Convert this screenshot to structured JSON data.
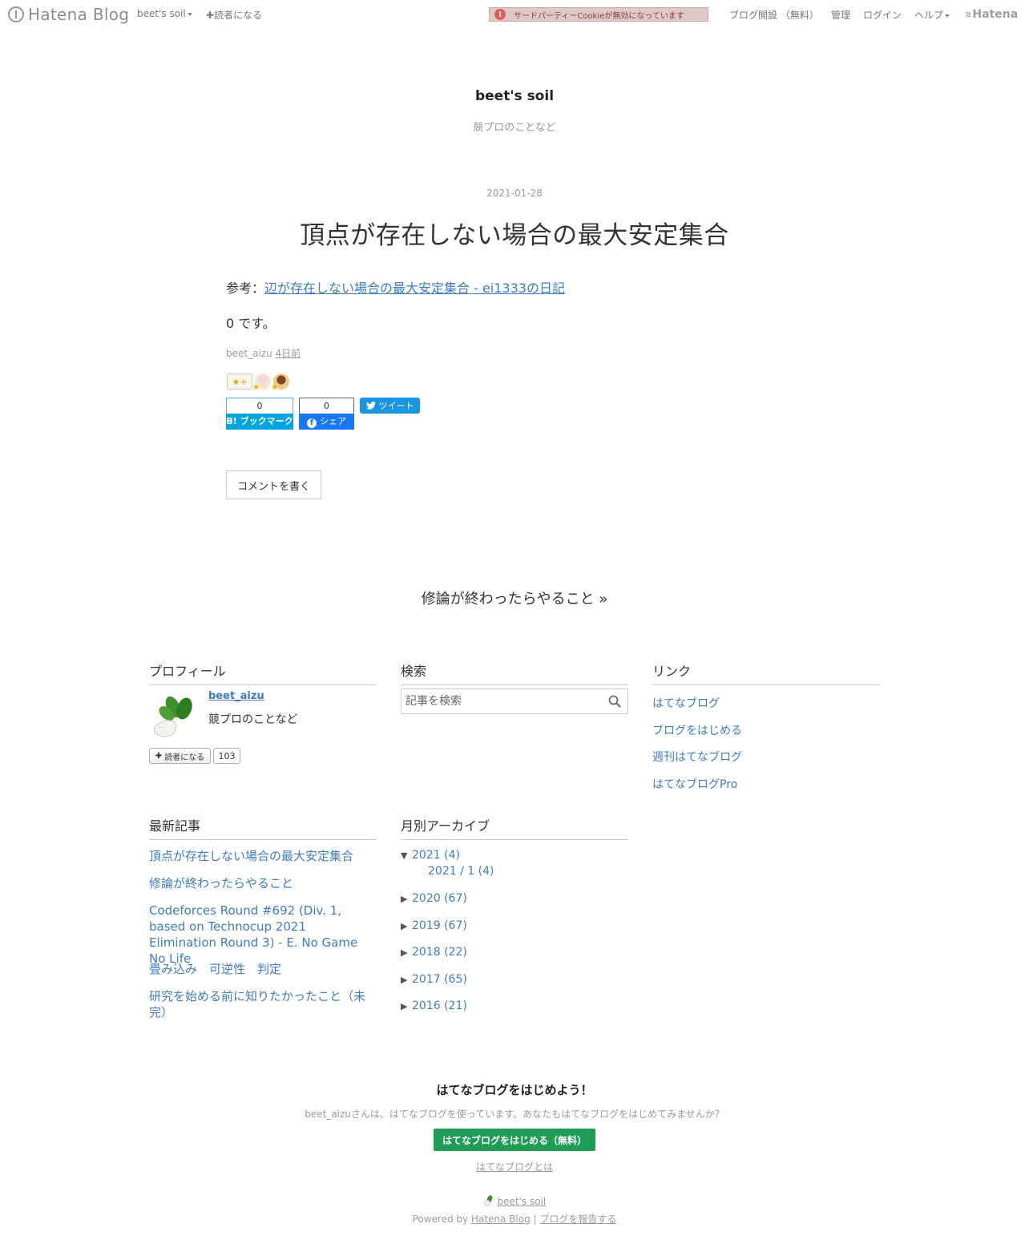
{
  "navbar": {
    "logo_text": "Hatena Blog",
    "blog_menu": "beet's soil",
    "subscribe": "読者になる",
    "cookie_warning": "サードパーティーCookieが無効になっています",
    "open_blog": "ブログ開設 （無料）",
    "admin": "管理",
    "login": "ログイン",
    "help": "ヘルプ",
    "hatena": "Hatena"
  },
  "header": {
    "title": "beet's soil",
    "description": "競プロのことなど"
  },
  "entry": {
    "date": "2021-01-28",
    "title": "頂点が存在しない場合の最大安定集合",
    "ref_prefix": "参考：",
    "ref_link": "辺が存在しない場合の最大安定集合 - ei1333の日記",
    "body": "0 です。",
    "author": "beet_aizu",
    "time": "4日前",
    "star_add": "★+",
    "bookmark_count": "0",
    "bookmark_label": "B! ブックマーク",
    "fb_count": "0",
    "fb_label": "シェア",
    "tweet_label": "ツイート",
    "comment_button": "コメントを書く"
  },
  "pager": {
    "next": "修論が終わったらやること »"
  },
  "profile": {
    "heading": "プロフィール",
    "name": "beet_aizu",
    "description": "競プロのことなど",
    "subscribe": "読者になる",
    "subscriber_count": "103"
  },
  "search": {
    "heading": "検索",
    "placeholder": "記事を検索"
  },
  "links": {
    "heading": "リンク",
    "items": [
      "はてなブログ",
      "ブログをはじめる",
      "週刊はてなブログ",
      "はてなブログPro"
    ]
  },
  "recent": {
    "heading": "最新記事",
    "items": [
      "頂点が存在しない場合の最大安定集合",
      "修論が終わったらやること",
      "Codeforces Round #692 (Div. 1, based on Technocup 2021 Elimination Round 3) - E. No Game No Life",
      "畳み込み　可逆性　判定",
      "研究を始める前に知りたかったこと（未完）"
    ]
  },
  "archive": {
    "heading": "月別アーカイブ",
    "expanded_marker": "▼",
    "collapsed_marker": "▶",
    "years": [
      {
        "label": "2021 (4)"
      },
      {
        "label": "2020 (67)"
      },
      {
        "label": "2019 (67)"
      },
      {
        "label": "2018 (22)"
      },
      {
        "label": "2017 (65)"
      },
      {
        "label": "2016 (21)"
      }
    ],
    "month": "2021 / 1 (4)"
  },
  "footer": {
    "cta_title": "はてなブログをはじめよう！",
    "cta_desc": "beet_aizuさんは、はてなブログを使っています。あなたもはてなブログをはじめてみませんか？",
    "cta_button": "はてなブログをはじめる（無料）",
    "cta_about": "はてなブログとは",
    "blog_name": "beet's soil",
    "powered_prefix": "Powered by",
    "powered_link": "Hatena Blog",
    "separator": "|",
    "report": "ブログを報告する"
  },
  "colors": {
    "link": "#3d7cbe",
    "bookmark": "#00a4de",
    "facebook": "#1877f2",
    "twitter": "#1b95e0",
    "cta": "#1f9d55"
  }
}
